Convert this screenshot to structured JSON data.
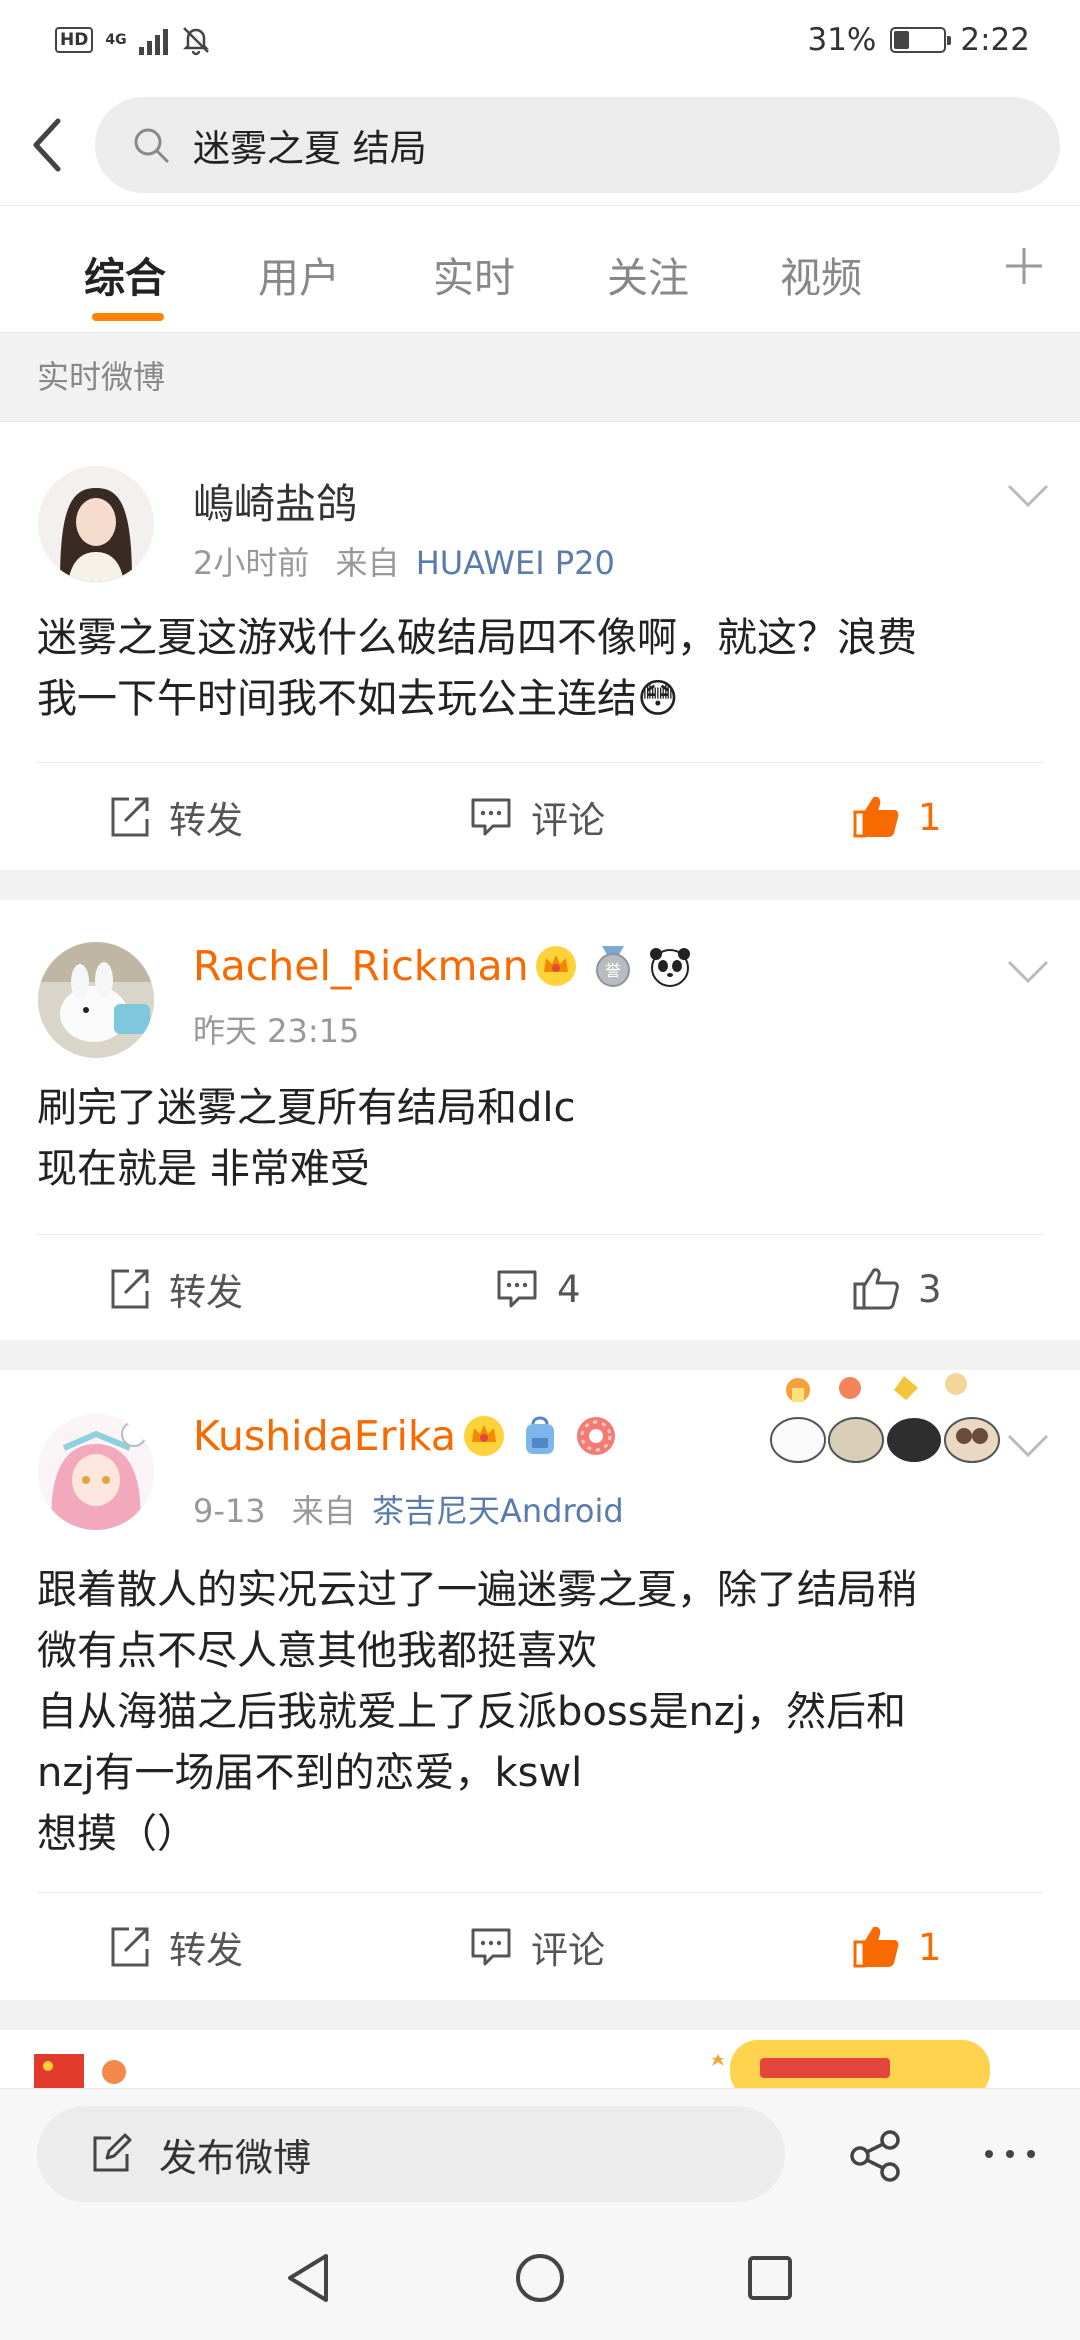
{
  "status_bar": {
    "hd": "HD",
    "network": "4G",
    "battery": "31%",
    "battery_level": 0.31,
    "time": "2:22"
  },
  "search": {
    "query": "迷雾之夏 结局"
  },
  "tabs": [
    {
      "label": "综合",
      "active": true
    },
    {
      "label": "用户"
    },
    {
      "label": "实时"
    },
    {
      "label": "关注"
    },
    {
      "label": "视频"
    }
  ],
  "section": {
    "label": "实时微博"
  },
  "posts": [
    {
      "username": "嶋崎盐鸽",
      "time": "2小时前",
      "source_prefix": "来自",
      "source": "HUAWEI P20",
      "text_lines": [
        "迷雾之夏这游戏什么破结局四不像啊，就这？浪费",
        "我一下午时间我不如去玩公主连结😳"
      ],
      "repost_label": "转发",
      "comment_label": "评论",
      "likes": "1",
      "liked": true
    },
    {
      "username": "Rachel_Rickman",
      "time": "昨天 23:15",
      "text_lines": [
        "刷完了迷雾之夏所有结局和dlc",
        "现在就是  非常难受"
      ],
      "repost_label": "转发",
      "comments": "4",
      "likes": "3",
      "liked": false
    },
    {
      "username": "KushidaErika",
      "time": "9-13",
      "source_prefix": "来自",
      "source": "茶吉尼天Android",
      "text_lines": [
        "跟着散人的实况云过了一遍迷雾之夏，除了结局稍",
        "微有点不尽人意其他我都挺喜欢",
        "自从海猫之后我就爱上了反派boss是nzj，然后和",
        "nzj有一场届不到的恋爱，kswl",
        "想摸（）"
      ],
      "repost_label": "转发",
      "comment_label": "评论",
      "likes": "1",
      "liked": true
    }
  ],
  "compose": {
    "label": "发布微博"
  },
  "colors": {
    "accent": "#ff8200",
    "vip_name": "#f86a00",
    "link": "#5a7bab",
    "separator": "#f2f2f2"
  }
}
